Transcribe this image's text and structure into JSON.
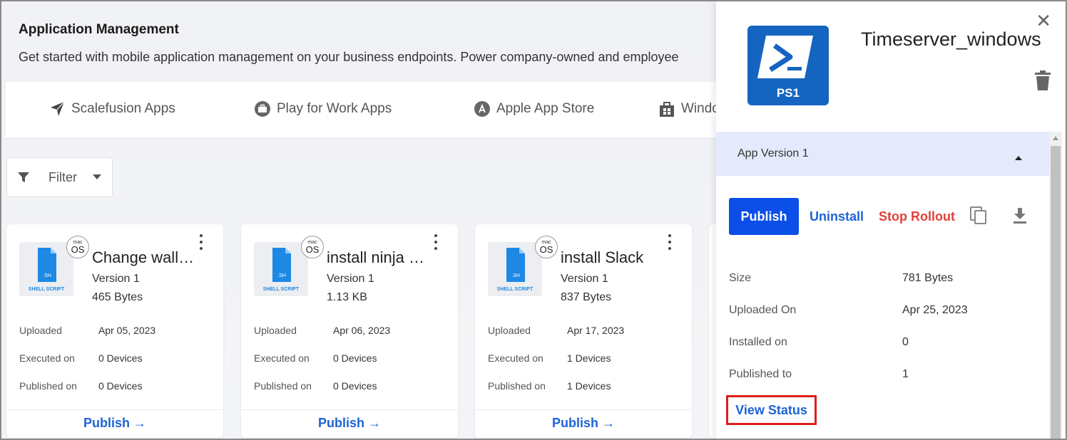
{
  "page": {
    "title": "Application Management",
    "subtitle": "Get started with mobile application management on your business endpoints. Power company-owned and employee"
  },
  "tabs": [
    {
      "label": "Scalefusion Apps",
      "icon": "scalefusion-icon"
    },
    {
      "label": "Play for Work Apps",
      "icon": "briefcase-icon"
    },
    {
      "label": "Apple App Store",
      "icon": "app-store-icon"
    },
    {
      "label": "Windo",
      "icon": "store-icon"
    }
  ],
  "filter": {
    "label": "Filter"
  },
  "card_labels": {
    "uploaded": "Uploaded",
    "executed": "Executed on",
    "published": "Published on",
    "publish_action": "Publish",
    "icon_caption": "SHELL SCRIPT",
    "icon_ext": ".SH",
    "badge_top": "mac",
    "badge_bottom": "OS"
  },
  "cards": [
    {
      "name": "Change wall…",
      "version": "Version 1",
      "size": "465 Bytes",
      "uploaded": "Apr 05, 2023",
      "executed": "0 Devices",
      "published": "0 Devices"
    },
    {
      "name": "install ninja …",
      "version": "Version 1",
      "size": "1.13 KB",
      "uploaded": "Apr 06, 2023",
      "executed": "0 Devices",
      "published": "0 Devices"
    },
    {
      "name": "install Slack",
      "version": "Version 1",
      "size": "837 Bytes",
      "uploaded": "Apr 17, 2023",
      "executed": "1 Devices",
      "published": "1 Devices"
    }
  ],
  "panel": {
    "app_title": "Timeserver_windows",
    "icon_label": "PS1",
    "version_label": "App Version 1",
    "actions": {
      "publish": "Publish",
      "uninstall": "Uninstall",
      "stop_rollout": "Stop Rollout"
    },
    "details": [
      {
        "label": "Size",
        "value": "781 Bytes"
      },
      {
        "label": "Uploaded On",
        "value": "Apr 25, 2023"
      },
      {
        "label": "Installed on",
        "value": "0"
      },
      {
        "label": "Published to",
        "value": "1"
      }
    ],
    "view_status": "View Status",
    "colors": {
      "primary": "#0c4fe8",
      "link": "#1d62d6",
      "danger": "#e0413a",
      "highlight": "#e01d1d",
      "icon_bg": "#1565c0"
    }
  }
}
